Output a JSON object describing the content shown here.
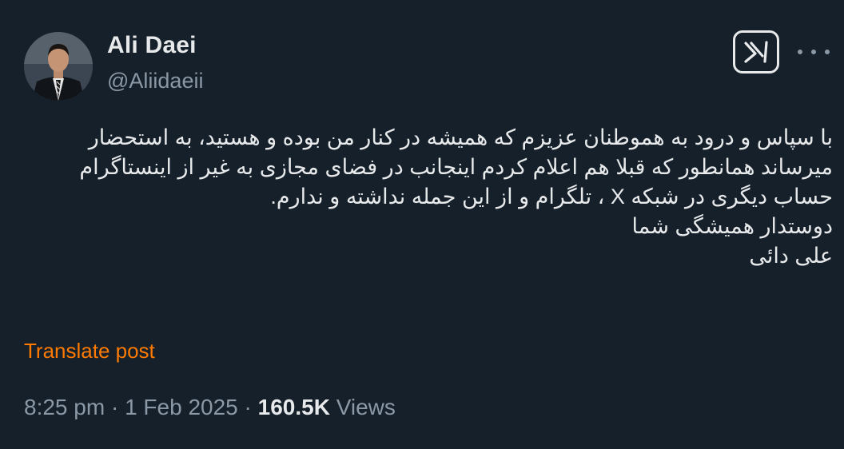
{
  "author": {
    "name": "Ali Daei",
    "handle": "@Aliidaeii"
  },
  "icons": {
    "grok": "grok-icon",
    "more": "more-horizontal-icon"
  },
  "tweet": {
    "lines": [
      "با سپاس و درود به هموطنان عزیزم که همیشه در کنار من بوده و هستید، به استحضار",
      "میرساند همانطور که قبلا هم اعلام کردم اینجانب در فضای مجازی به غیر از اینستاگرام",
      "حساب دیگری در شبکه X ، تلگرام و از این جمله نداشته و ندارم.",
      "دوستدار همیشگی شما",
      "علی دائی"
    ],
    "translate_label": "Translate post"
  },
  "meta": {
    "time": "8:25 pm",
    "separator": "·",
    "date": "1 Feb 2025",
    "views_count": "160.5K",
    "views_label": "Views"
  },
  "colors": {
    "background": "#15202b",
    "text": "#e7e9ea",
    "secondary": "#8b98a5",
    "translate": "#ff7a00"
  }
}
